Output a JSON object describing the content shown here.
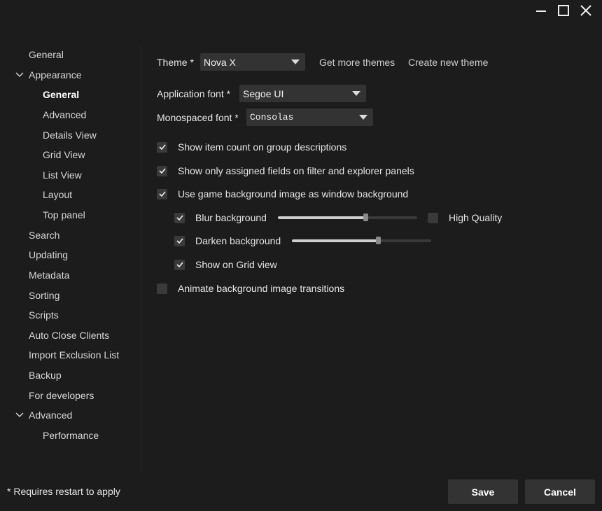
{
  "window": {
    "minimize_icon": "minimize-icon",
    "maximize_icon": "maximize-icon",
    "close_icon": "close-icon"
  },
  "sidebar": {
    "items": [
      {
        "label": "General"
      },
      {
        "label": "Appearance"
      },
      {
        "label": "General"
      },
      {
        "label": "Advanced"
      },
      {
        "label": "Details View"
      },
      {
        "label": "Grid View"
      },
      {
        "label": "List View"
      },
      {
        "label": "Layout"
      },
      {
        "label": "Top panel"
      },
      {
        "label": "Search"
      },
      {
        "label": "Updating"
      },
      {
        "label": "Metadata"
      },
      {
        "label": "Sorting"
      },
      {
        "label": "Scripts"
      },
      {
        "label": "Auto Close Clients"
      },
      {
        "label": "Import Exclusion List"
      },
      {
        "label": "Backup"
      },
      {
        "label": "For developers"
      },
      {
        "label": "Advanced"
      },
      {
        "label": "Performance"
      }
    ]
  },
  "theme": {
    "label": "Theme *",
    "value": "Nova X",
    "get_more": "Get more themes",
    "create_new": "Create new theme"
  },
  "app_font": {
    "label": "Application font *",
    "value": "Segoe UI"
  },
  "mono_font": {
    "label": "Monospaced font *",
    "value": "Consolas"
  },
  "options": {
    "item_count": {
      "label": "Show item count on group descriptions",
      "checked": true
    },
    "assigned_fields": {
      "label": "Show only assigned fields on filter and explorer panels",
      "checked": true
    },
    "game_bg": {
      "label": "Use game background image as window background",
      "checked": true
    },
    "blur": {
      "label": "Blur background",
      "checked": true,
      "level": 0.63
    },
    "high_quality": {
      "label": "High Quality",
      "checked": false
    },
    "darken": {
      "label": "Darken background",
      "checked": true,
      "level": 0.62
    },
    "grid_view": {
      "label": "Show on Grid view",
      "checked": true
    },
    "animate": {
      "label": "Animate background image transitions",
      "checked": false
    }
  },
  "footer": {
    "note": "* Requires restart to apply",
    "save": "Save",
    "cancel": "Cancel"
  },
  "colors": {
    "background": "#1c1c1c",
    "control": "#333333",
    "text": "#e6e6e6"
  }
}
